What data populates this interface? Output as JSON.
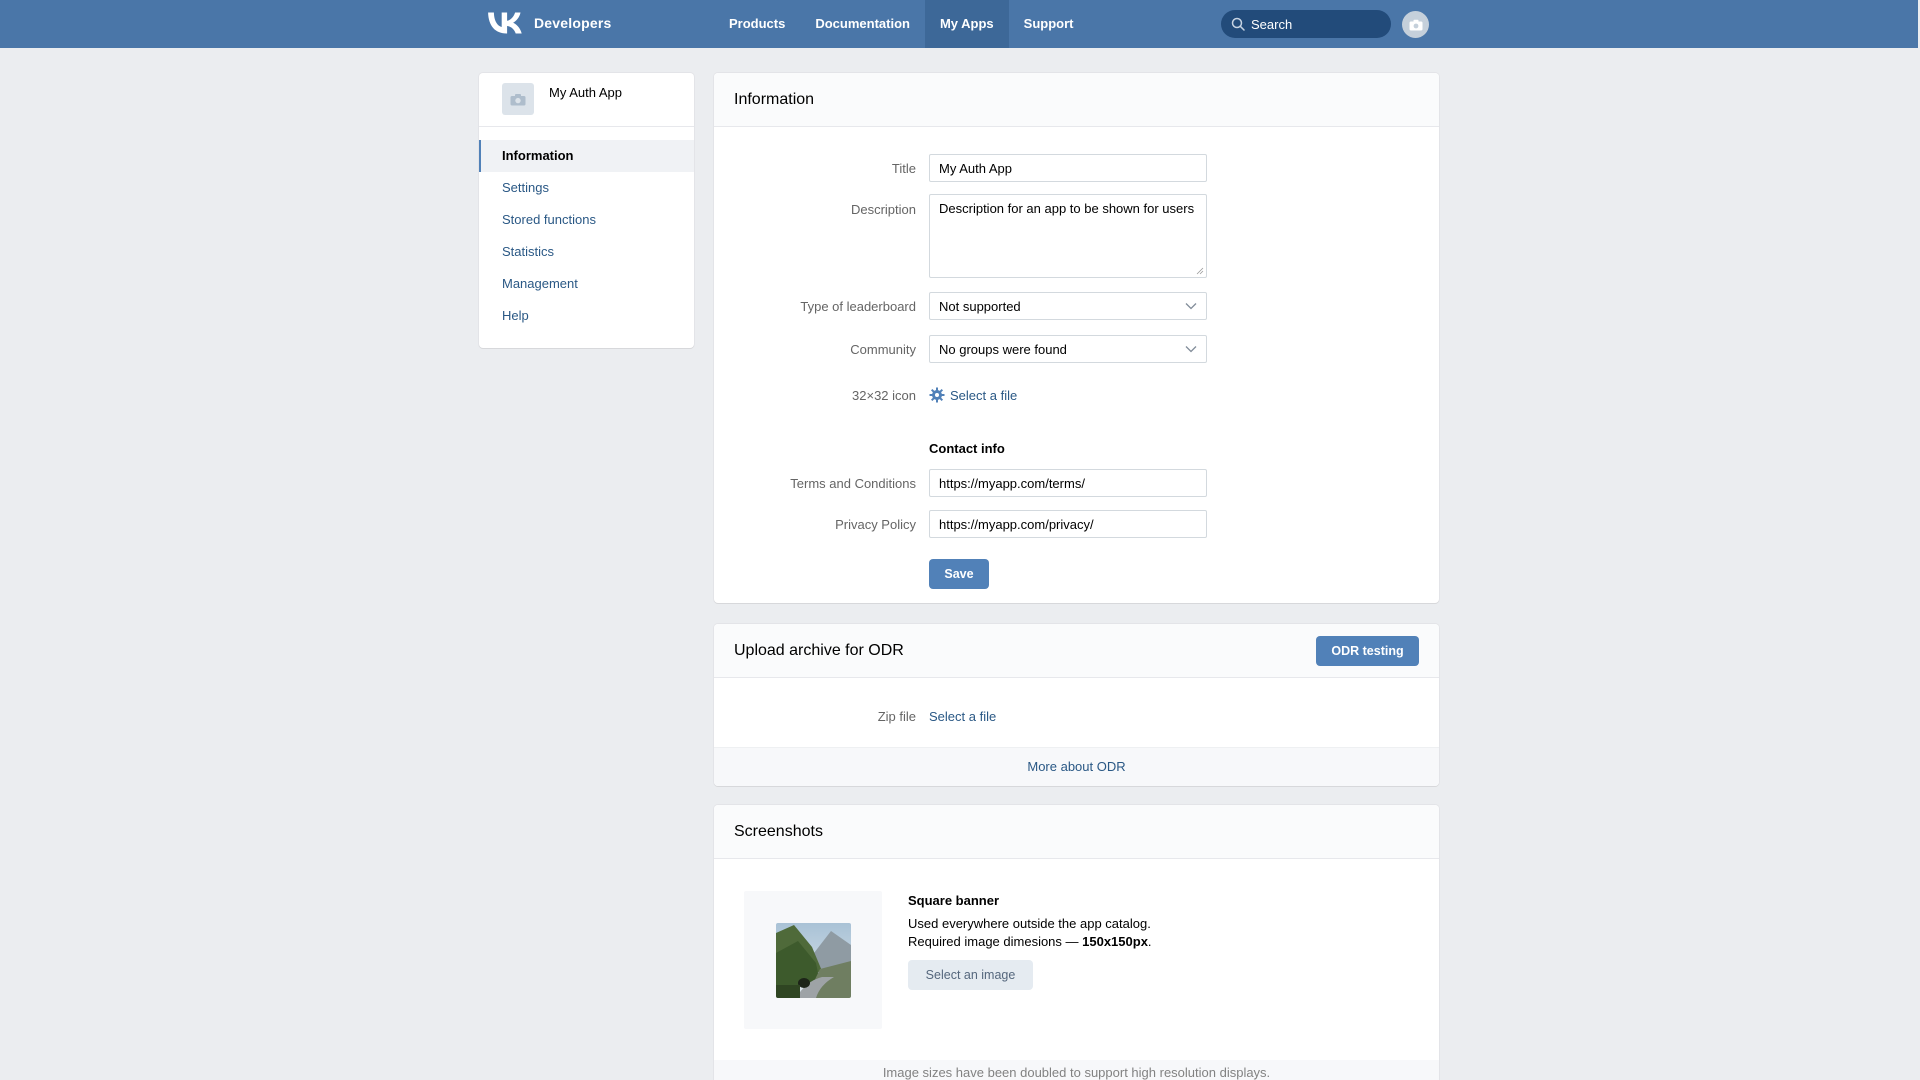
{
  "header": {
    "brand": "Developers",
    "nav": [
      {
        "label": "Products",
        "active": false
      },
      {
        "label": "Documentation",
        "active": false
      },
      {
        "label": "My Apps",
        "active": true
      },
      {
        "label": "Support",
        "active": false
      }
    ],
    "search_placeholder": "Search",
    "colors": {
      "bar": "#4a76a8",
      "active": "#3d6898",
      "search": "#224b7a"
    }
  },
  "sidebar": {
    "app_name": "My Auth App",
    "items": [
      {
        "label": "Information",
        "active": true
      },
      {
        "label": "Settings",
        "active": false
      },
      {
        "label": "Stored functions",
        "active": false
      },
      {
        "label": "Statistics",
        "active": false
      },
      {
        "label": "Management",
        "active": false
      },
      {
        "label": "Help",
        "active": false
      }
    ]
  },
  "info": {
    "title": "Information",
    "title_label": "Title",
    "title_value": "My Auth App",
    "description_label": "Description",
    "description_value": "Description for an app to be shown for users",
    "leaderboard_label": "Type of leaderboard",
    "leaderboard_value": "Not supported",
    "community_label": "Community",
    "community_value": "No groups were found",
    "icon_label": "32×32 icon",
    "icon_link": "Select a file",
    "contact_heading": "Contact info",
    "terms_label": "Terms and Conditions",
    "terms_value": "https://myapp.com/terms/",
    "privacy_label": "Privacy Policy",
    "privacy_value": "https://myapp.com/privacy/",
    "save_label": "Save"
  },
  "odr": {
    "title": "Upload archive for ODR",
    "testing_button": "ODR testing",
    "zip_label": "Zip file",
    "zip_link": "Select a file",
    "more_link": "More about ODR"
  },
  "screenshots": {
    "title": "Screenshots",
    "banner_heading": "Square banner",
    "banner_line1": "Used everywhere outside the app catalog.",
    "banner_line2_prefix": "Required image dimesions — ",
    "banner_line2_size": "150x150px",
    "banner_line2_suffix": ".",
    "select_image_label": "Select an image",
    "footer_note": "Image sizes have been doubled to support high resolution displays."
  },
  "accent_color": "#5181b8",
  "link_color": "#2a5885"
}
